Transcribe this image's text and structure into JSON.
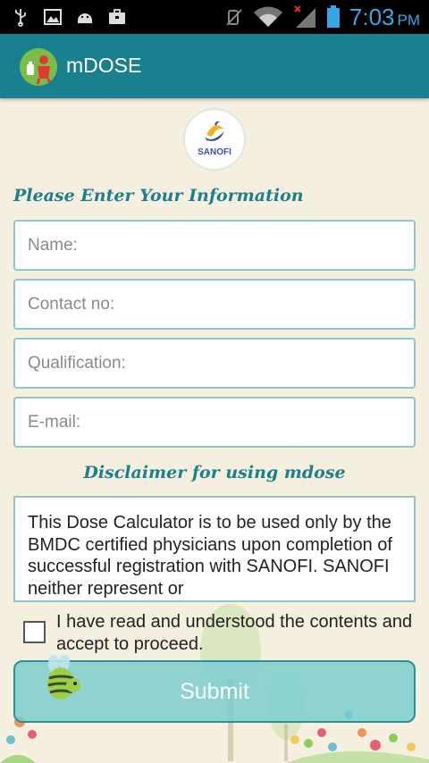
{
  "status_bar": {
    "time": "7:03",
    "ampm": "PM",
    "left_icons": [
      "usb-icon",
      "image-icon",
      "android-icon",
      "briefcase-icon"
    ],
    "right_icons": [
      "mute-icon",
      "wifi-icon",
      "signal-icon",
      "battery-icon"
    ]
  },
  "app_bar": {
    "title": "mDOSE"
  },
  "logo": {
    "text": "SANOFI"
  },
  "form": {
    "heading": "Please Enter Your Information",
    "name_placeholder": "Name:",
    "contact_placeholder": "Contact no:",
    "qualification_placeholder": "Qualification:",
    "email_placeholder": "E-mail:"
  },
  "disclaimer": {
    "heading": "Disclaimer for using mdose",
    "text": "This Dose Calculator is to be used only by the BMDC certified physicians upon completion of successful registration with SANOFI. SANOFI neither represent or"
  },
  "agree": {
    "label": "I have read and understood the contents and accept to proceed.",
    "checked": false
  },
  "submit": {
    "label": "Submit"
  },
  "colors": {
    "accent": "#1a7f8e",
    "background": "#f4efdf",
    "clock": "#35a7e6"
  }
}
